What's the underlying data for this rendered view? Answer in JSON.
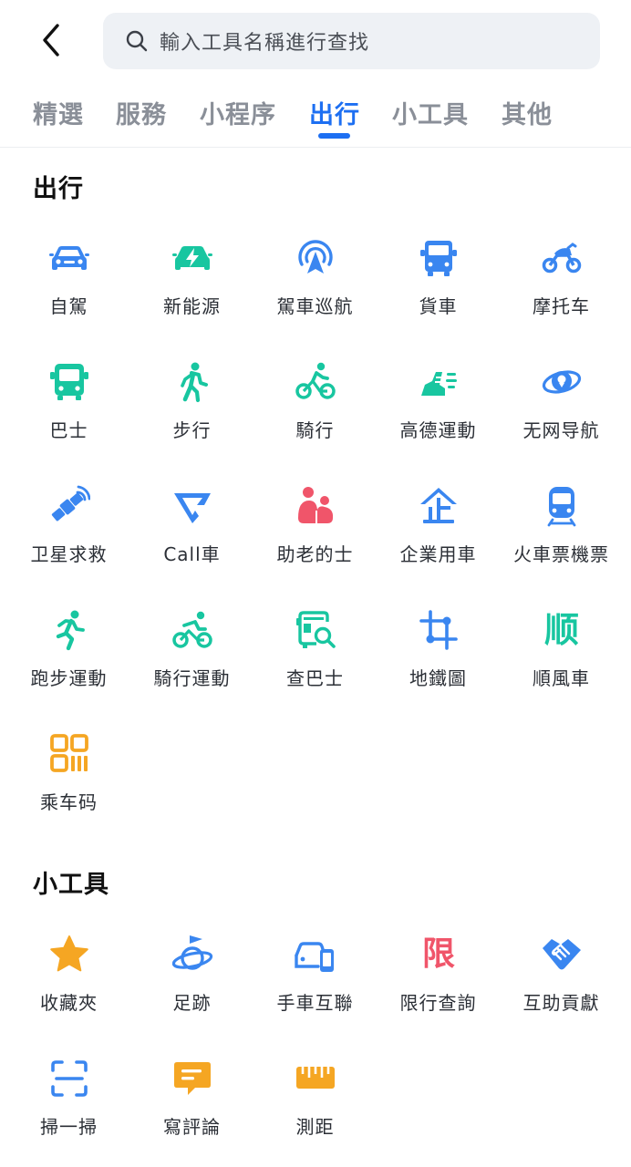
{
  "colors": {
    "accent": "#1d6ff2",
    "blue_icon": "#3a86f0",
    "green_icon": "#18c6a0",
    "red_icon": "#f0556a",
    "orange_icon": "#f5a623"
  },
  "search": {
    "placeholder": "輸入工具名稱進行查找",
    "icon": "search-icon"
  },
  "tabs": [
    {
      "label": "精選"
    },
    {
      "label": "服務"
    },
    {
      "label": "小程序"
    },
    {
      "label": "出行",
      "active": true
    },
    {
      "label": "小工具"
    },
    {
      "label": "其他"
    }
  ],
  "sections": [
    {
      "title": "出行",
      "items": [
        {
          "label": "自駕",
          "icon": "car-icon"
        },
        {
          "label": "新能源",
          "icon": "ev-car-icon"
        },
        {
          "label": "駕車巡航",
          "icon": "cruise-icon"
        },
        {
          "label": "貨車",
          "icon": "truck-icon"
        },
        {
          "label": "摩托车",
          "icon": "motorcycle-icon"
        },
        {
          "label": "巴士",
          "icon": "bus-icon"
        },
        {
          "label": "步行",
          "icon": "walk-icon"
        },
        {
          "label": "騎行",
          "icon": "bike-icon"
        },
        {
          "label": "高德運動",
          "icon": "run-shoe-icon"
        },
        {
          "label": "无网导航",
          "icon": "offline-nav-icon"
        },
        {
          "label": "卫星求救",
          "icon": "satellite-icon"
        },
        {
          "label": "Call車",
          "icon": "call-car-icon"
        },
        {
          "label": "助老的士",
          "icon": "elder-taxi-icon"
        },
        {
          "label": "企業用車",
          "icon": "enterprise-car-icon"
        },
        {
          "label": "火車票機票",
          "icon": "train-icon"
        },
        {
          "label": "跑步運動",
          "icon": "running-icon"
        },
        {
          "label": "騎行運動",
          "icon": "cycling-sport-icon"
        },
        {
          "label": "查巴士",
          "icon": "bus-search-icon"
        },
        {
          "label": "地鐵圖",
          "icon": "metro-map-icon"
        },
        {
          "label": "順風車",
          "icon": "carpool-icon",
          "glyph": "顺"
        },
        {
          "label": "乘车码",
          "icon": "qr-code-icon"
        }
      ]
    },
    {
      "title": "小工具",
      "items": [
        {
          "label": "收藏夾",
          "icon": "star-icon"
        },
        {
          "label": "足跡",
          "icon": "footprint-planet-icon"
        },
        {
          "label": "手車互聯",
          "icon": "phone-car-icon"
        },
        {
          "label": "限行查詢",
          "icon": "restriction-icon",
          "glyph": "限"
        },
        {
          "label": "互助貢獻",
          "icon": "handshake-icon"
        },
        {
          "label": "掃一掃",
          "icon": "scan-icon"
        },
        {
          "label": "寫評論",
          "icon": "comment-icon"
        },
        {
          "label": "測距",
          "icon": "ruler-icon"
        }
      ]
    }
  ]
}
